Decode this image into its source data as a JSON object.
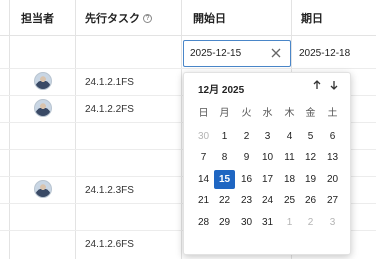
{
  "grid": {
    "columns": [
      {
        "label": "担当者"
      },
      {
        "label": "先行タスク",
        "has_info": true
      },
      {
        "label": "開始日"
      },
      {
        "label": "期日"
      }
    ],
    "info_glyph": "?",
    "rows": [
      {
        "start_date": "2025-12-15",
        "end_date": "2025-12-18",
        "editing": true
      },
      {
        "assignee": "avatar",
        "predecessor": "24.1.2.1FS"
      },
      {
        "assignee": "avatar",
        "predecessor": "24.1.2.2FS"
      },
      {},
      {
        "assignee": "avatar",
        "predecessor": "24.1.2.3FS"
      },
      {},
      {
        "predecessor": "24.1.2.6FS"
      }
    ]
  },
  "date_input": {
    "value": "2025-12-15",
    "clear_icon": "close-icon"
  },
  "end_date_value": "2025-12-18",
  "calendar": {
    "month_label": "12月 2025",
    "weekdays": [
      "日",
      "月",
      "火",
      "水",
      "木",
      "金",
      "土"
    ],
    "weeks": [
      [
        "30",
        "1",
        "2",
        "3",
        "4",
        "5",
        "6"
      ],
      [
        "7",
        "8",
        "9",
        "10",
        "11",
        "12",
        "13"
      ],
      [
        "14",
        "15",
        "16",
        "17",
        "18",
        "19",
        "20"
      ],
      [
        "21",
        "22",
        "23",
        "24",
        "25",
        "26",
        "27"
      ],
      [
        "28",
        "29",
        "30",
        "31",
        "1",
        "2",
        "3"
      ]
    ],
    "selected": "15",
    "accent_color": "#1f66c2",
    "nav_icons": [
      "arrow-up-icon",
      "arrow-down-icon"
    ]
  }
}
